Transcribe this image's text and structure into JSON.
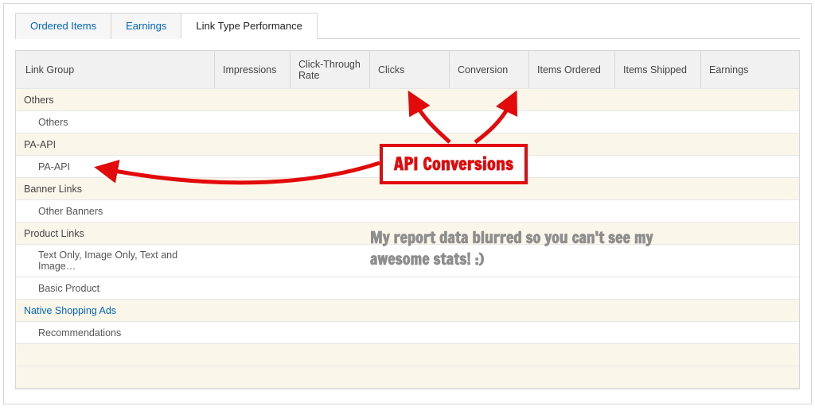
{
  "tabs": [
    {
      "label": "Ordered Items",
      "active": false
    },
    {
      "label": "Earnings",
      "active": false
    },
    {
      "label": "Link Type Performance",
      "active": true
    }
  ],
  "columns": {
    "link_group": "Link Group",
    "impressions": "Impressions",
    "ctr": "Click-Through Rate",
    "clicks": "Clicks",
    "conversion": "Conversion",
    "items_ordered": "Items Ordered",
    "items_shipped": "Items Shipped",
    "earnings": "Earnings"
  },
  "rows": [
    {
      "type": "group",
      "label": "Others"
    },
    {
      "type": "child",
      "label": "Others"
    },
    {
      "type": "group",
      "label": "PA-API"
    },
    {
      "type": "child",
      "label": "PA-API"
    },
    {
      "type": "group",
      "label": "Banner Links"
    },
    {
      "type": "child",
      "label": "Other Banners"
    },
    {
      "type": "group",
      "label": "Product Links"
    },
    {
      "type": "child",
      "label": "Text Only, Image Only, Text and Image…"
    },
    {
      "type": "child",
      "label": "Basic Product"
    },
    {
      "type": "link",
      "label": "Native Shopping Ads"
    },
    {
      "type": "child",
      "label": "Recommendations"
    },
    {
      "type": "empty",
      "label": ""
    },
    {
      "type": "empty",
      "label": ""
    }
  ],
  "annotations": {
    "box": "API Conversions",
    "caption": "My report data blurred so you can't see my awesome stats! :)"
  }
}
